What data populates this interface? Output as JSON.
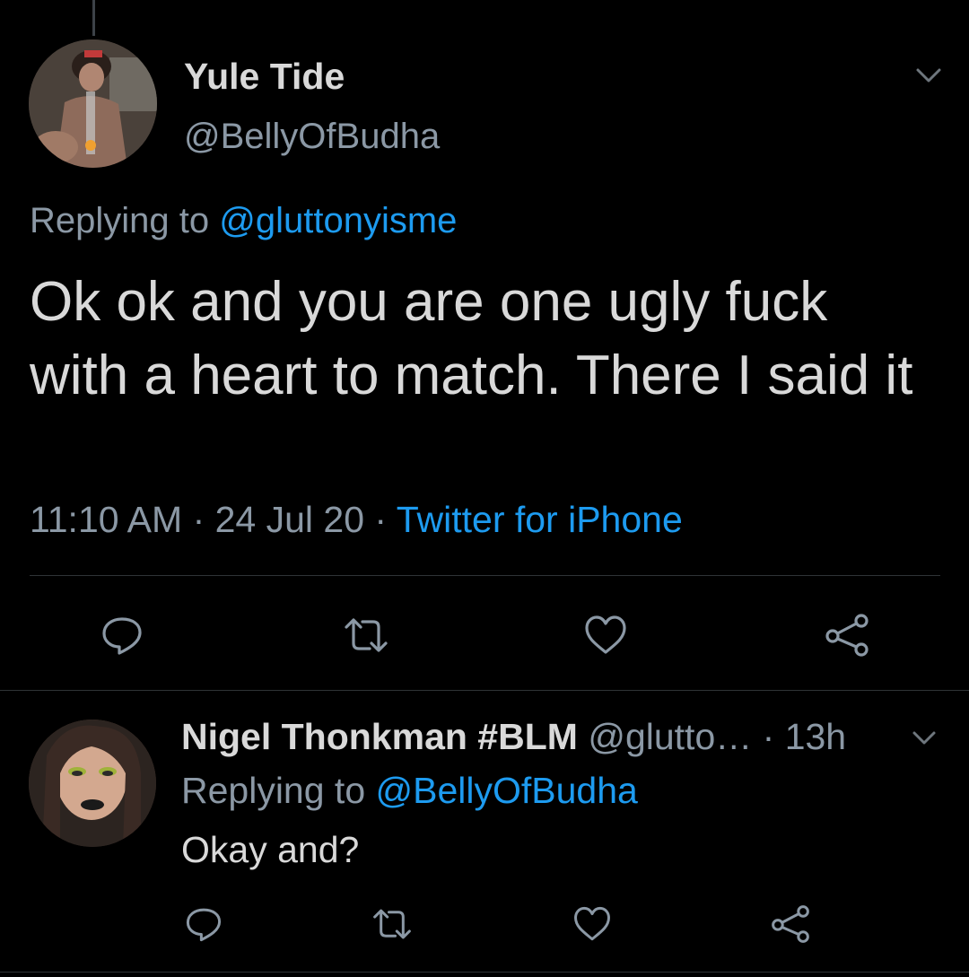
{
  "main_tweet": {
    "display_name": "Yule Tide",
    "handle": "@BellyOfBudha",
    "replying_prefix": "Replying to ",
    "replying_to": "@gluttonyisme",
    "text": "Ok ok and you are one ugly fuck with a heart to match. There I said it",
    "time": "11:10 AM",
    "separator": " · ",
    "date": "24 Jul 20",
    "source": "Twitter for iPhone",
    "actions": [
      "reply-icon",
      "retweet-icon",
      "like-icon",
      "share-icon"
    ]
  },
  "reply_tweet": {
    "display_name": "Nigel Thonkman #BLM",
    "handle": "@glutto…",
    "separator": " · ",
    "time": "13h",
    "replying_prefix": "Replying to ",
    "replying_to": "@BellyOfBudha",
    "text": "Okay and?",
    "actions": [
      "reply-icon",
      "retweet-icon",
      "like-icon",
      "share-icon"
    ]
  },
  "colors": {
    "background": "#000000",
    "text_primary": "#d9d9d9",
    "text_secondary": "#8b98a5",
    "accent": "#1d9bf0",
    "divider": "#2f3336"
  }
}
